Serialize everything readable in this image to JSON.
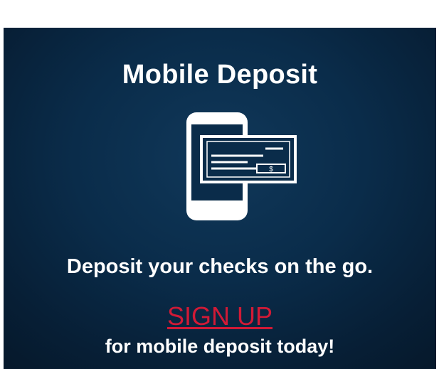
{
  "banner": {
    "title": "Mobile Deposit",
    "illustration": {
      "icon": "mobile-check-deposit-icon",
      "check_symbol": "$"
    },
    "tagline": "Deposit your checks on the go.",
    "cta_label": "SIGN UP",
    "cta_subtext": "for mobile deposit today!"
  },
  "colors": {
    "background": "#0a2c4a",
    "text": "#ffffff",
    "cta": "#d11a36"
  }
}
